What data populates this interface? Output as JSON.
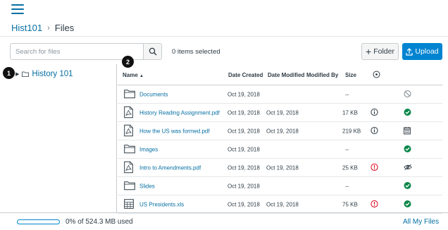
{
  "breadcrumb": {
    "course": "Hist101",
    "separator": "›",
    "current": "Files"
  },
  "search": {
    "placeholder": "Search for files",
    "value": ""
  },
  "selection": {
    "count_text": "0 items selected"
  },
  "toolbar": {
    "folder_label": "Folder",
    "folder_prefix": "+",
    "upload_label": "Upload"
  },
  "tree": {
    "root_label": "History 101"
  },
  "callouts": {
    "one": "1",
    "two": "2"
  },
  "table": {
    "headers": {
      "name": "Name",
      "name_sort": "▲",
      "created": "Date Created",
      "modified": "Date Modified",
      "modified_by": "Modified By",
      "size": "Size"
    },
    "rows": [
      {
        "type": "folder",
        "name": "Documents",
        "created": "Oct 19, 2018",
        "modified": "",
        "size": "--",
        "info": "",
        "status": "restricted"
      },
      {
        "type": "pdf",
        "name": "History Reading Assignment.pdf",
        "created": "Oct 19, 2018",
        "modified": "Oct 19, 2018",
        "size": "17 KB",
        "info": "info",
        "status": "published"
      },
      {
        "type": "pdf",
        "name": "How the US was formed.pdf",
        "created": "Oct 19, 2018",
        "modified": "Oct 19, 2018",
        "size": "219 KB",
        "info": "info",
        "status": "scheduled"
      },
      {
        "type": "folder",
        "name": "Images",
        "created": "Oct 19, 2018",
        "modified": "",
        "size": "--",
        "info": "",
        "status": "published"
      },
      {
        "type": "pdf",
        "name": "Intro to Amendments.pdf",
        "created": "Oct 19, 2018",
        "modified": "Oct 19, 2018",
        "size": "25 KB",
        "info": "warning",
        "status": "hidden"
      },
      {
        "type": "folder",
        "name": "Slides",
        "created": "Oct 19, 2018",
        "modified": "",
        "size": "--",
        "info": "",
        "status": "published"
      },
      {
        "type": "xls",
        "name": "US Presidents.xls",
        "created": "Oct 19, 2018",
        "modified": "Oct 19, 2018",
        "size": "75 KB",
        "info": "warning",
        "status": "published"
      }
    ]
  },
  "footer": {
    "quota_text": "0% of 524.3 MB used",
    "quota_fraction": 0,
    "all_files": "All My Files"
  },
  "colors": {
    "link": "#0770a3",
    "primary": "#0084d1",
    "success": "#0b874b",
    "warning": "#e0061f",
    "muted": "#73818c"
  }
}
